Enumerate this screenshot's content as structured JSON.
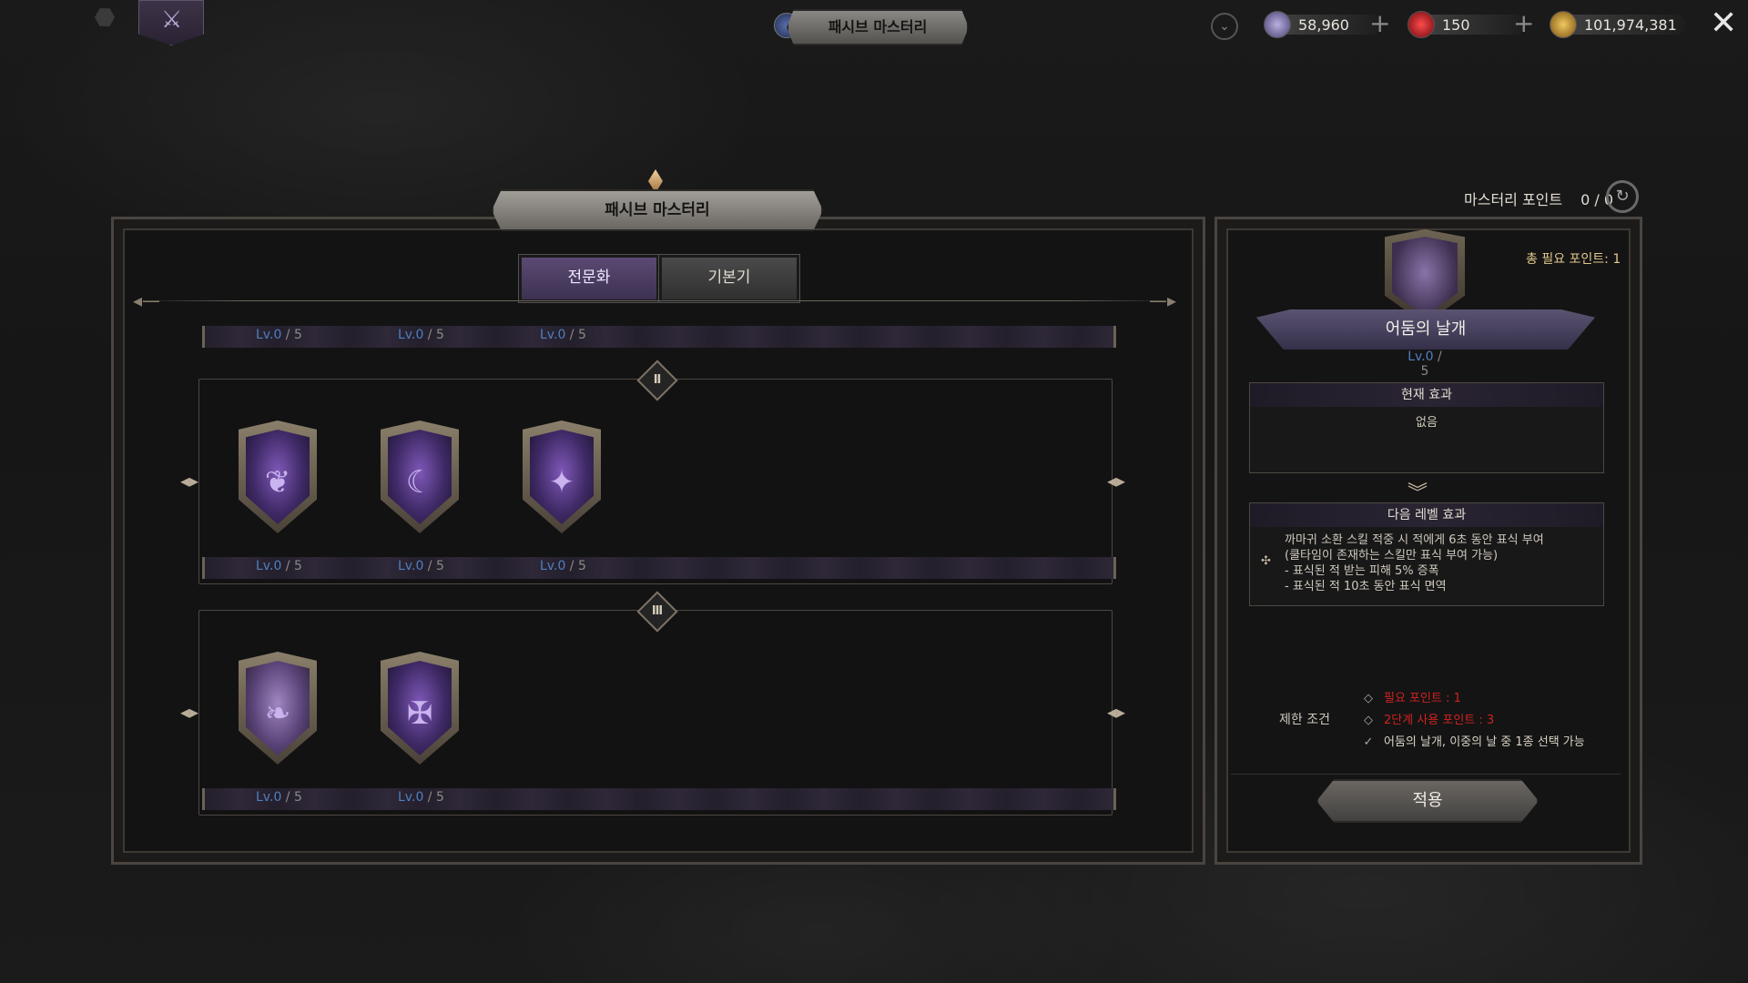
{
  "header": {
    "title": "패시브 마스터리",
    "currencies": [
      {
        "name": "crystal",
        "value": "58,960",
        "icon": "crystal-icon",
        "color": "#8a80b8"
      },
      {
        "name": "ruby",
        "value": "150",
        "icon": "ruby-icon",
        "color": "#c81e2a"
      },
      {
        "name": "gold",
        "value": "101,974,381",
        "icon": "gold-coin-icon",
        "color": "#c49a3a"
      }
    ]
  },
  "panel": {
    "title": "패시브 마스터리",
    "tabs": [
      {
        "label": "전문화",
        "active": true
      },
      {
        "label": "기본기",
        "active": false
      }
    ],
    "tiers": [
      {
        "roman": "Ⅱ"
      },
      {
        "roman": "Ⅲ"
      }
    ],
    "levels": {
      "lv": "Lv.0",
      "max": " / 5"
    }
  },
  "detail": {
    "mastery_points_label": "마스터리 포인트",
    "mastery_points_value": "0 / 0",
    "total_required": "총 필요 포인트: 1",
    "skill_name": "어둠의 날개",
    "skill_level": "Lv.0",
    "skill_level_max": " / 5",
    "current_effect_title": "현재 효과",
    "current_effect_value": "없음",
    "next_effect_title": "다음 레벨 효과",
    "next_effect_lines": [
      "까마귀 소환 스킬 적중 시 적에게 6초 동안 표식 부여",
      "(쿨타임이 존재하는 스킬만 표식 부여 가능)",
      "- 표식된 적 받는 피해 5% 증폭",
      "- 표식된 적 10초 동안 표식 면역"
    ],
    "conditions_label": "제한 조건",
    "conditions": [
      {
        "text": "필요 포인트 : 1",
        "state": "unmet"
      },
      {
        "text": "2단계 사용 포인트 : 3",
        "state": "unmet"
      },
      {
        "text": "어둠의 날개, 이중의 날 중 1종 선택 가능",
        "state": "met"
      }
    ],
    "apply_label": "적용"
  },
  "colors": {
    "accent_purple": "#5b4a74",
    "level_blue": "#4f7fc0",
    "warning_red": "#d0221f",
    "highlight_gold": "#e2c98e"
  }
}
